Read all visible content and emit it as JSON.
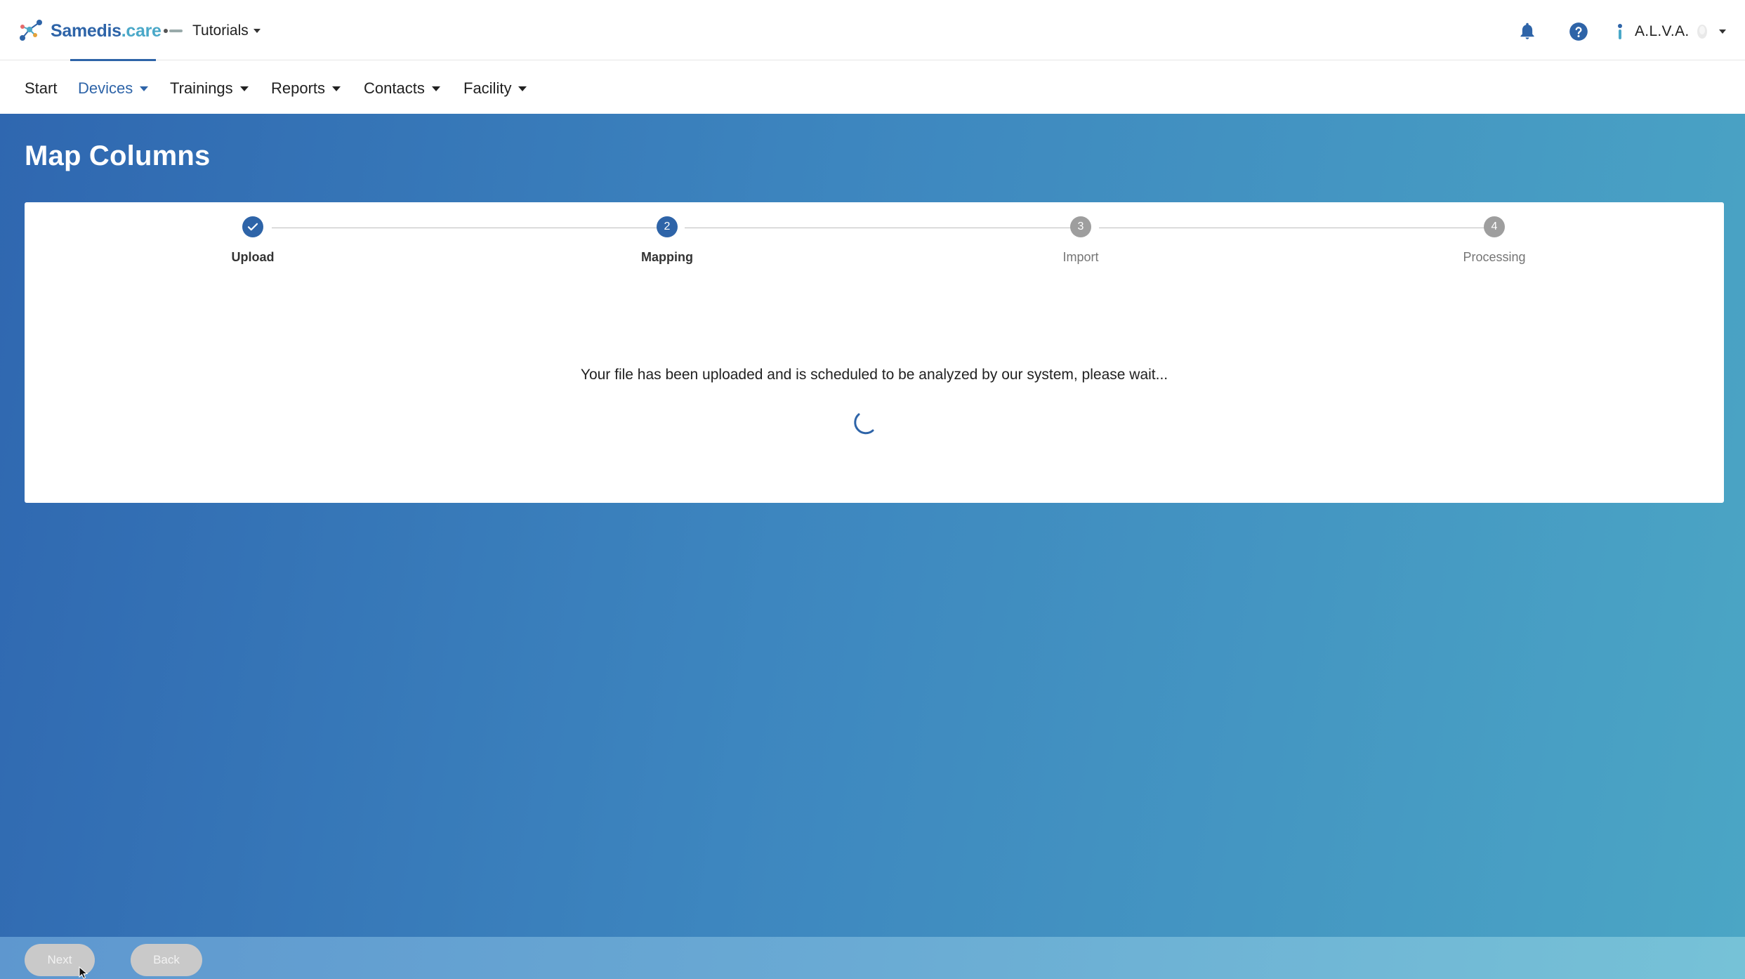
{
  "header": {
    "brand_primary": "Samedis",
    "brand_secondary": ".care",
    "tenant_label": "Tutorials",
    "user_name": "A.L.V.A."
  },
  "nav": {
    "items": [
      {
        "label": "Start",
        "has_menu": false,
        "active": false
      },
      {
        "label": "Devices",
        "has_menu": true,
        "active": true
      },
      {
        "label": "Trainings",
        "has_menu": true,
        "active": false
      },
      {
        "label": "Reports",
        "has_menu": true,
        "active": false
      },
      {
        "label": "Contacts",
        "has_menu": true,
        "active": false
      },
      {
        "label": "Facility",
        "has_menu": true,
        "active": false
      }
    ]
  },
  "page": {
    "title": "Map Columns"
  },
  "stepper": {
    "steps": [
      {
        "number": "1",
        "label": "Upload",
        "state": "done"
      },
      {
        "number": "2",
        "label": "Mapping",
        "state": "active"
      },
      {
        "number": "3",
        "label": "Import",
        "state": "pending"
      },
      {
        "number": "4",
        "label": "Processing",
        "state": "pending"
      }
    ]
  },
  "status": {
    "message": "Your file has been uploaded and is scheduled to be analyzed by our system, please wait..."
  },
  "actions": {
    "next_label": "Next",
    "back_label": "Back"
  },
  "colors": {
    "accent": "#2e64a8",
    "brand_secondary": "#4aa8c8",
    "pending_step": "#9e9e9e",
    "disabled_button": "#c9c9c9"
  },
  "icons": {
    "brand": "samedis-molecule-icon",
    "notifications": "bell-icon",
    "help": "help-circle-icon",
    "step_done": "check-icon",
    "loading": "spinner-icon"
  }
}
